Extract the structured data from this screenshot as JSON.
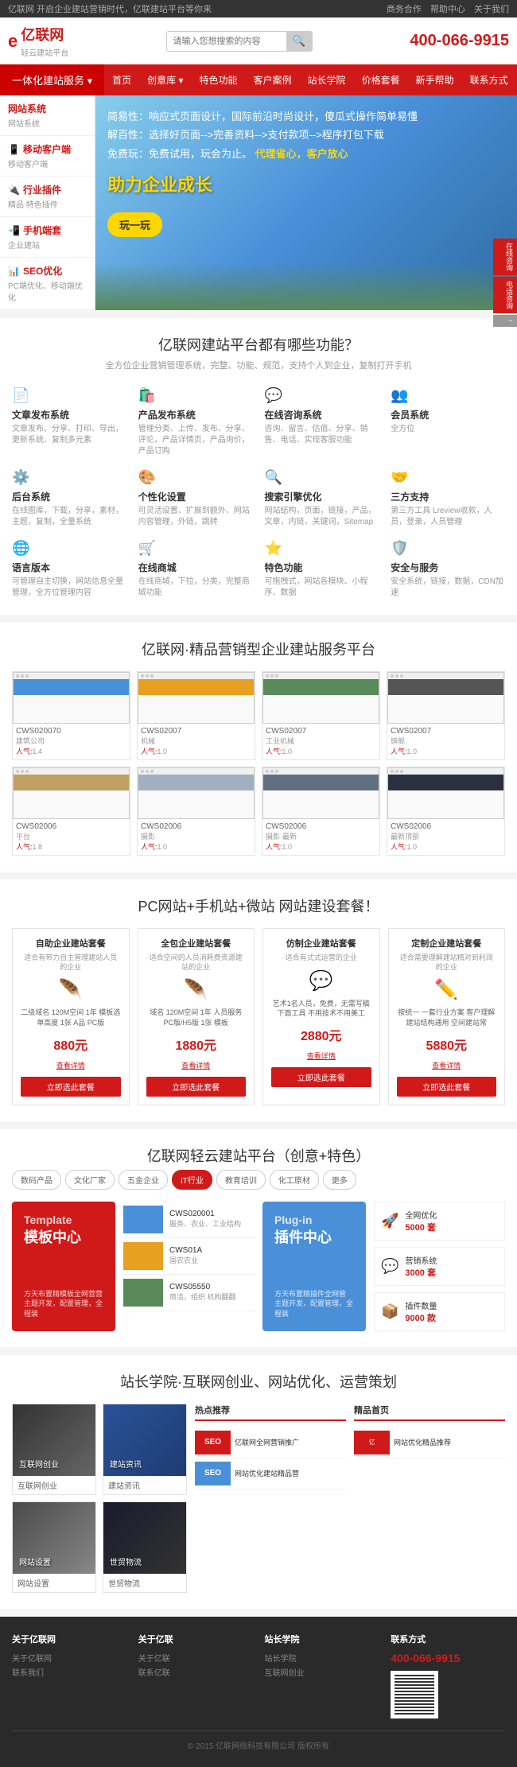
{
  "topbar": {
    "left_text": "亿联网 开启企业建站营销时代，亿联建站平台等你来",
    "links": [
      "商务合作",
      "帮助中心",
      "关于我们"
    ]
  },
  "header": {
    "logo_icon": "e",
    "logo_name": "亿联网",
    "logo_tagline": "轻云建站平台",
    "search_placeholder": "请输入您想搜索的内容",
    "phone_label": "400-066-9915"
  },
  "nav": {
    "dropdown_label": "一体化建站服务 ▾",
    "items": [
      "首页",
      "创意库 ▾",
      "特色功能",
      "客户案例",
      "站长学院",
      "价格套餐",
      "新手帮助",
      "联系方式"
    ]
  },
  "sidebar": {
    "items": [
      {
        "cat": "网站系统",
        "sub": "网站系统"
      },
      {
        "cat": "移动客户端",
        "sub": "移动客户端"
      },
      {
        "cat": "行业插件",
        "sub": "精品 特色插件"
      },
      {
        "cat": "手机端套",
        "sub": "企业建站"
      },
      {
        "cat": "SEO优化",
        "sub": "PC端优化、移动端优化"
      }
    ]
  },
  "hero": {
    "line1": "简易性：响应式页面设计，国际前沿时尚设计，傻瓜式操作简单易懂",
    "line2": "解百性：选择好页面-->完善资料-->支付款项-->程序打包下载",
    "line3": "免费玩：免费试用，玩会为止。",
    "highlight": "代理省心，客户放心",
    "big_text": "助力企业成长",
    "btn": "玩一玩"
  },
  "features": {
    "section_title": "亿联网建站平台都有哪些功能？",
    "section_sub": "全方位企业营销管理系统，完整、功能、规范，支持个人到企业，复制打开手机",
    "items": [
      {
        "icon": "📄",
        "name": "文章发布系统",
        "desc": "文章发布、分享、打印、导出，更新系统、复制多元素"
      },
      {
        "icon": "🛍️",
        "name": "产品发布系统",
        "desc": "管理分类、上传、发布、分享、评论，产品详情页，产品询价，产品订购"
      },
      {
        "icon": "💬",
        "name": "在线咨询系统",
        "desc": "咨询、留言、估值、分享、销售、电话、实现客服功能"
      },
      {
        "icon": "👥",
        "name": "会员系统",
        "desc": "全方位"
      },
      {
        "icon": "⚙️",
        "name": "后台系统",
        "desc": "在线图库，下载，分享，素材，主题，复制，全量系统"
      },
      {
        "icon": "🎨",
        "name": "个性化设置",
        "desc": "可灵活设置、扩展到额外、网站内容管理，外链，跳转"
      },
      {
        "icon": "🔍",
        "name": "搜索引擎优化",
        "desc": "网站结构，页面，链接，产品，文章，内链，关键词，Sitemap"
      },
      {
        "icon": "🤝",
        "name": "三方支持",
        "desc": "第三方工具 Lreview收款，人员，登录，人员管理"
      },
      {
        "icon": "🌐",
        "name": "语言版本",
        "desc": "可管理自主切换，网站信息全量管理，全方位管理内容"
      },
      {
        "icon": "🛒",
        "name": "在线商城",
        "desc": "在线商城，下拉，分类，完整商城功能"
      },
      {
        "icon": "⭐",
        "name": "特色功能",
        "desc": "可拖拽式，网站各模块、小程序、数据"
      },
      {
        "icon": "🛡️",
        "name": "安全与服务",
        "desc": "安全系统，链接，数据，CDN加速"
      }
    ]
  },
  "templates": {
    "section_title": "亿联网·精品营销型企业建站服务平台",
    "items": [
      {
        "id": "CWS020070",
        "name": "建筑公司",
        "heat": "1.4",
        "color": "blue"
      },
      {
        "id": "CWS02007",
        "name": "机械",
        "heat": "1.0",
        "color": "orange"
      },
      {
        "id": "CWS02007",
        "name": "工业机械",
        "heat": "1.0",
        "color": "green"
      },
      {
        "id": "CWS02007",
        "name": "旗舰",
        "heat": "1.0",
        "color": "dark"
      },
      {
        "id": "CWS02006",
        "name": "平台",
        "heat": "1.8",
        "color": "blue2"
      },
      {
        "id": "CWS02006",
        "name": "摄影",
        "heat": "1.0",
        "color": "orange2"
      },
      {
        "id": "CWS02006",
        "name": "摄影·最新",
        "heat": "1.0",
        "color": "green2"
      },
      {
        "id": "CWS02006",
        "name": "最新顶部",
        "heat": "1.0",
        "color": "dark2"
      }
    ]
  },
  "pricing": {
    "section_title": "PC网站+手机站+微站  网站建设套餐！",
    "packages": [
      {
        "title": "自助企业建站套餐",
        "desc": "适合有带力自主管理建站人员的企业",
        "icon": "🪶",
        "icon_color": "#5a8a5a",
        "features": "二级域名 120M空间 1年 模板选单高度 1张 A品 PC版",
        "price": "880元",
        "detail_label": "查看详情",
        "btn_label": "立即选此套餐"
      },
      {
        "title": "全包企业建站套餐",
        "desc": "适合空间的人员消耗费资源建站的企业",
        "icon": "🪶",
        "icon_color": "#d01a1a",
        "features": "域名 120M空间 1年 人员服务 PC版/H5版 1张 模板",
        "price": "1880元",
        "detail_label": "查看详情",
        "btn_label": "立即选此套餐"
      },
      {
        "title": "仿制企业建站套餐",
        "desc": "适合有式式运营的企业",
        "icon": "💬",
        "icon_color": "#d01a1a",
        "features": "艺术1名人员，免费，无需写稿 下面工具 不用技术不用美工",
        "price": "2880元",
        "detail_label": "查看详情",
        "btn_label": "立即选此套餐"
      },
      {
        "title": "定制企业建站套餐",
        "desc": "适合需要理解建站精对到利润的企业",
        "icon": "✏️",
        "icon_color": "#d01a1a",
        "features": "按统一 一套行业方案 客户理解 建站结构通用 空间建站常",
        "price": "5880元",
        "detail_label": "查看详情",
        "btn_label": "立即选此套餐"
      }
    ]
  },
  "platform": {
    "section_title": "亿联网轻云建站平台（创意+特色）",
    "tabs": [
      "数码产品",
      "文化厂家",
      "五金企业",
      "IT行业",
      "教育培训",
      "化工原材",
      "更多"
    ],
    "active_tab": "IT行业",
    "template_banner": {
      "en_text": "Template",
      "cn_text": "模板中心",
      "desc": "方天布置精模板全网营营 主题开发，配置管理，全程装"
    },
    "plugin_banner": {
      "en_text": "Plug-in",
      "cn_text": "插件中心",
      "desc": "方天布置精插件全网管 主题开发，配置管理，全程装"
    },
    "list_items": [
      {
        "id": "CWS020001",
        "name": "服务、农业、工业结构"
      },
      {
        "id": "CWS01A",
        "name": "国农农业"
      },
      {
        "id": "CWS05550",
        "name": "简洁，组织 机构翻翻"
      }
    ],
    "right_items": [
      {
        "icon": "🚀",
        "label": "全网优化",
        "count": "5000 套"
      },
      {
        "icon": "💬",
        "label": "营销系统",
        "count": "3000 套"
      },
      {
        "icon": "📦",
        "label": "插件数量",
        "count": "9000 款"
      }
    ]
  },
  "academy": {
    "section_title": "站长学院·互联网创业、网站优化、运营策划",
    "articles": [
      {
        "img_type": "dark",
        "label": "互联网创业",
        "caption": "互联网创业"
      },
      {
        "img_type": "blue",
        "label": "建站资讯",
        "caption": "建站资讯"
      },
      {
        "img_type": "gray",
        "label": "网站设置",
        "caption": "网站设置"
      },
      {
        "img_type": "dark2",
        "label": "世贸物流",
        "caption": "世贸物流"
      }
    ],
    "hot_title": "热点推荐",
    "premium_title": "精品首页",
    "recs": [
      {
        "name": "SEO",
        "color": "red",
        "label": "亿联网全网营销推广"
      },
      {
        "name": "SEO",
        "color": "blue",
        "label": "网站优化建站精品营"
      }
    ]
  },
  "footer": {
    "cols": [
      {
        "title": "关于亿联网",
        "links": [
          "关于亿联网",
          "联系我们"
        ]
      },
      {
        "title": "关于亿联",
        "links": [
          "关于亿联",
          "联系亿联"
        ]
      },
      {
        "title": "站长学院",
        "links": [
          "站长学院",
          "互联网创业"
        ]
      },
      {
        "title": "联系方式",
        "links": [
          "400-066-9915"
        ]
      }
    ],
    "bottom_text": "© 2015 亿联网络科技有限公司 版权所有"
  },
  "float_sidebar": {
    "items": [
      "在线咨询",
      "电话咨询",
      "返回顶部"
    ]
  }
}
